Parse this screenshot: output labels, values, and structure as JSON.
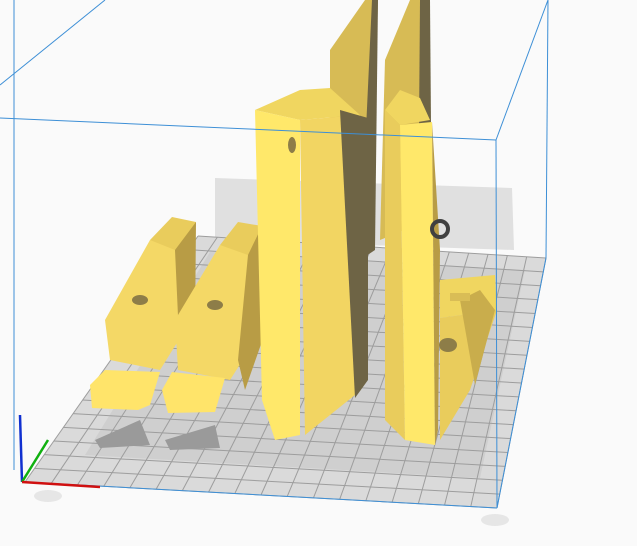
{
  "viewport": {
    "view": "3d-build-volume",
    "colors": {
      "background": "#fafafa",
      "volume_edge": "#3d8fd6",
      "plate": "#d6d6d6",
      "grid": "#9a9a9a",
      "model_light": "#ffe86a",
      "model_mid": "#e9cc5c",
      "model_shade": "#c9ad4c",
      "model_dark": "#6e6445",
      "axis_x": "#d01010",
      "axis_y": "#10b010",
      "axis_z": "#1030d0"
    }
  }
}
